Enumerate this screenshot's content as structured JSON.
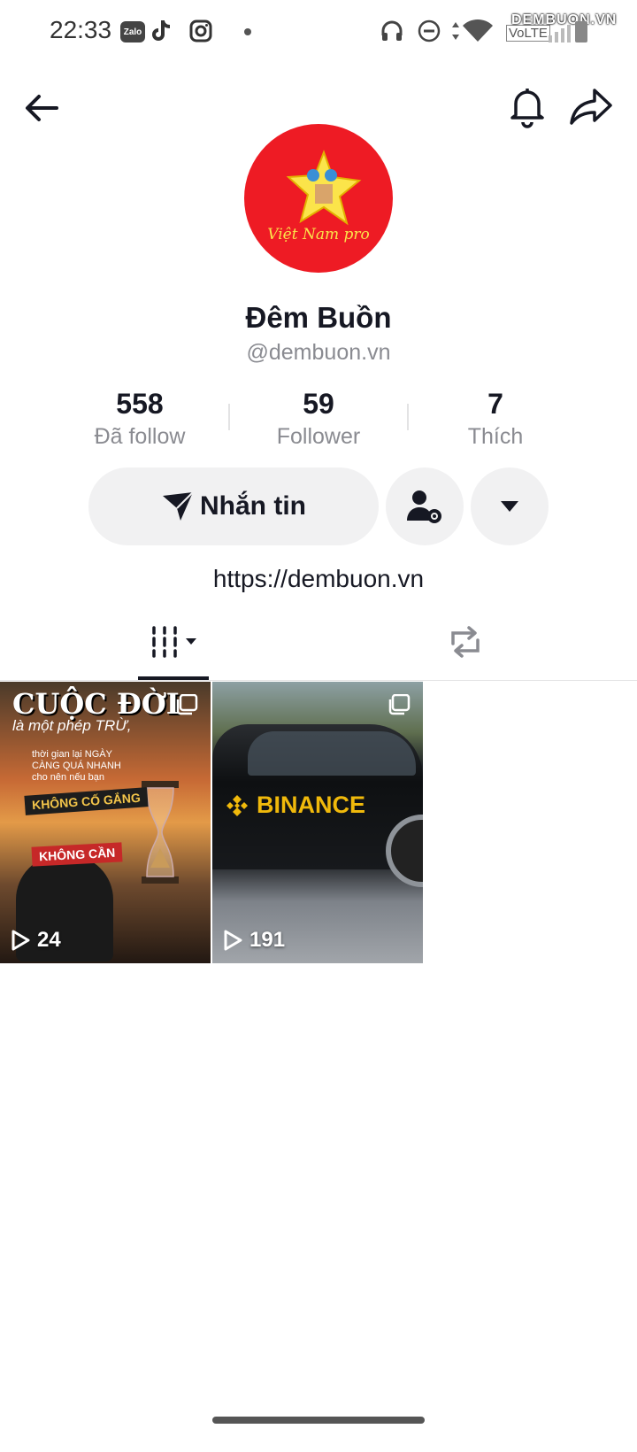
{
  "status_bar": {
    "time": "22:33",
    "zalo_label": "Zalo",
    "volte": "VoLTE",
    "watermark": "DEMBUON.VN"
  },
  "profile": {
    "avatar_text": "Việt Nam pro",
    "display_name": "Đêm Buồn",
    "username": "@dembuon.vn",
    "stats": [
      {
        "value": "558",
        "label": "Đã follow"
      },
      {
        "value": "59",
        "label": "Follower"
      },
      {
        "value": "7",
        "label": "Thích"
      }
    ],
    "message_button": "Nhắn tin",
    "bio_link": "https://dembuon.vn"
  },
  "videos": [
    {
      "views": "24",
      "poster": {
        "line1": "CUỘC ĐỜI",
        "line2": "là một phép TRỪ,",
        "line3": "thời gian lại NGÀY CÀNG QUÁ NHANH cho nên nếu bạn",
        "line4": "KHÔNG CỐ GẮNG",
        "line5": "KHÔNG CẦN"
      }
    },
    {
      "views": "191",
      "brand_text": "BINANCE"
    }
  ],
  "colors": {
    "avatar_bg": "#ee1b24",
    "binance": "#f0b90b",
    "button_bg": "#f1f1f2",
    "muted_text": "#8a8b91"
  }
}
